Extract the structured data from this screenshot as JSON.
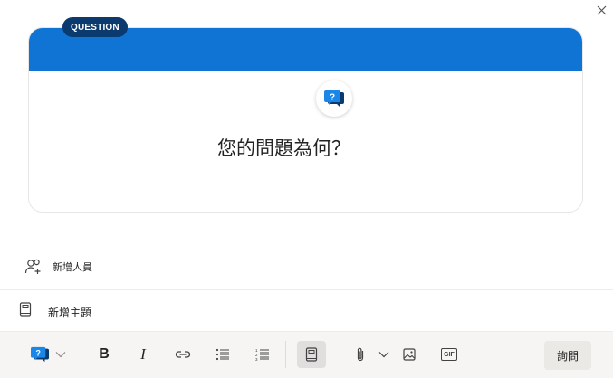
{
  "dialog": {
    "close_icon": "close-icon"
  },
  "card": {
    "type_tag": "QUESTION",
    "type_icon": "question-bubble-icon",
    "banner_color": "#0f74d4",
    "tag_color": "#0b3a6e",
    "question_placeholder": "您的問題為何？"
  },
  "people": {
    "icon": "add-people-icon",
    "label": "新增人員"
  },
  "topics": {
    "icon": "book-icon",
    "label": "新增主題"
  },
  "toolbar": {
    "post_type_icon": "question-bubble-icon",
    "post_type_dropdown_icon": "chevron-down-icon",
    "bold_label": "B",
    "italic_label": "I",
    "link_icon": "link-icon",
    "bulleted_list_icon": "bulleted-list-icon",
    "numbered_list_icon": "numbered-list-icon",
    "topic_icon": "book-icon",
    "attach_icon": "paperclip-icon",
    "attach_dropdown_icon": "chevron-down-icon",
    "image_icon": "image-icon",
    "gif_label": "GIF",
    "submit_label": "詢問"
  }
}
